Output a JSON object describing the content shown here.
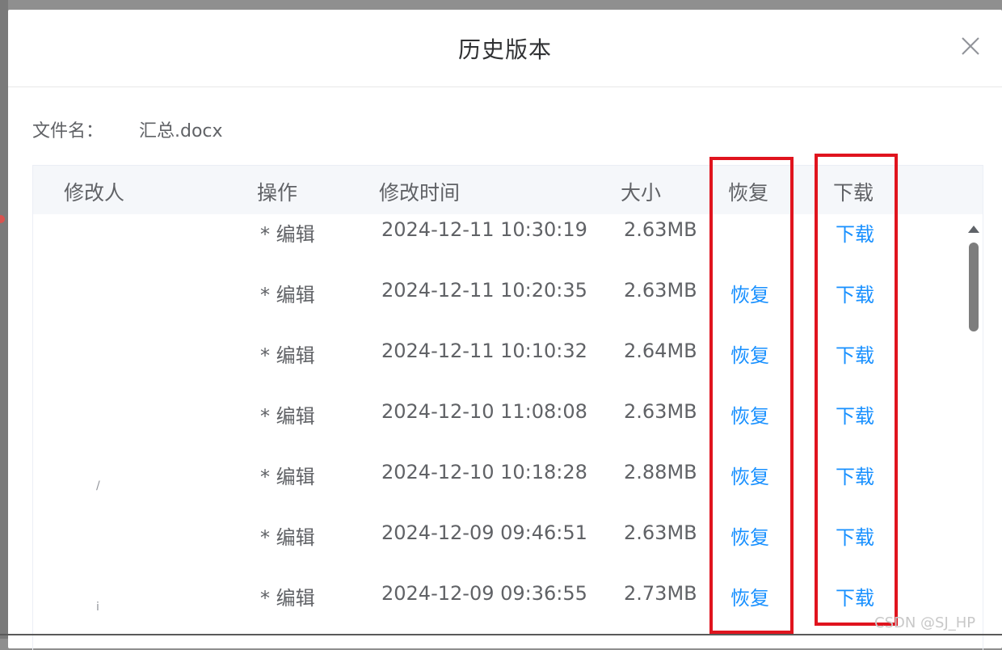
{
  "dialog": {
    "title": "历史版本",
    "close_icon": "close-icon"
  },
  "file": {
    "label": "文件名：",
    "name": "汇总.docx"
  },
  "table": {
    "headers": {
      "modifier": "修改人",
      "action": "操作",
      "time": "修改时间",
      "size": "大小",
      "restore": "恢复",
      "download": "下载"
    },
    "rows": [
      {
        "modifier": "",
        "action": "* 编辑",
        "time": "2024-12-11 10:30:19",
        "size": "2.63MB",
        "restore": "",
        "download": "下载"
      },
      {
        "modifier": "",
        "action": "* 编辑",
        "time": "2024-12-11 10:20:35",
        "size": "2.63MB",
        "restore": "恢复",
        "download": "下载"
      },
      {
        "modifier": "",
        "action": "* 编辑",
        "time": "2024-12-11 10:10:32",
        "size": "2.64MB",
        "restore": "恢复",
        "download": "下载"
      },
      {
        "modifier": "",
        "action": "* 编辑",
        "time": "2024-12-10 11:08:08",
        "size": "2.63MB",
        "restore": "恢复",
        "download": "下载"
      },
      {
        "modifier": "/",
        "action": "* 编辑",
        "time": "2024-12-10 10:18:28",
        "size": "2.88MB",
        "restore": "恢复",
        "download": "下载"
      },
      {
        "modifier": "",
        "action": "* 编辑",
        "time": "2024-12-09 09:46:51",
        "size": "2.63MB",
        "restore": "恢复",
        "download": "下载"
      },
      {
        "modifier": "i",
        "action": "* 编辑",
        "time": "2024-12-09 09:36:55",
        "size": "2.73MB",
        "restore": "恢复",
        "download": "下载"
      }
    ]
  },
  "annotation": {
    "color": "#e0141e"
  },
  "watermark": "CSDN @SJ_HP",
  "colors": {
    "link": "#1890ff",
    "text": "#606266",
    "header_bg": "#f5f7fa"
  }
}
